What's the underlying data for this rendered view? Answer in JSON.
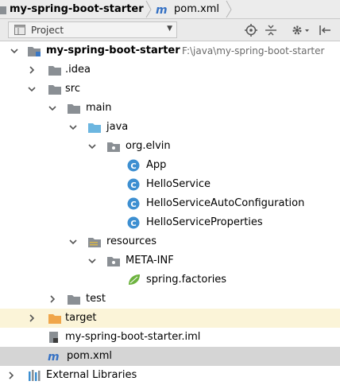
{
  "breadcrumb": {
    "project": "my-spring-boot-starter",
    "file": "pom.xml"
  },
  "toolwindow": {
    "view": "Project"
  },
  "tree": {
    "root": {
      "label": "my-spring-boot-starter",
      "path": "F:\\java\\my-spring-boot-starter"
    },
    "idea": "idea",
    "src": "src",
    "main": "main",
    "java": "java",
    "package": "org.elvin",
    "classes": [
      "App",
      "HelloService",
      "HelloServiceAutoConfiguration",
      "HelloServiceProperties"
    ],
    "resources": "resources",
    "meta_inf": "META-INF",
    "spring_factories": "spring.factories",
    "test": "test",
    "target": "target",
    "iml": "my-spring-boot-starter.iml",
    "pom": "pom.xml",
    "external": "External Libraries"
  },
  "colors": {
    "folder": "#8a8f94",
    "source_folder": "#6cb6e0",
    "target_folder": "#f0a64a",
    "class_icon": "#3d8fd1",
    "maven": "#3571c4",
    "selection": "#d5d5d5",
    "target_highlight": "#fbf4d8"
  }
}
